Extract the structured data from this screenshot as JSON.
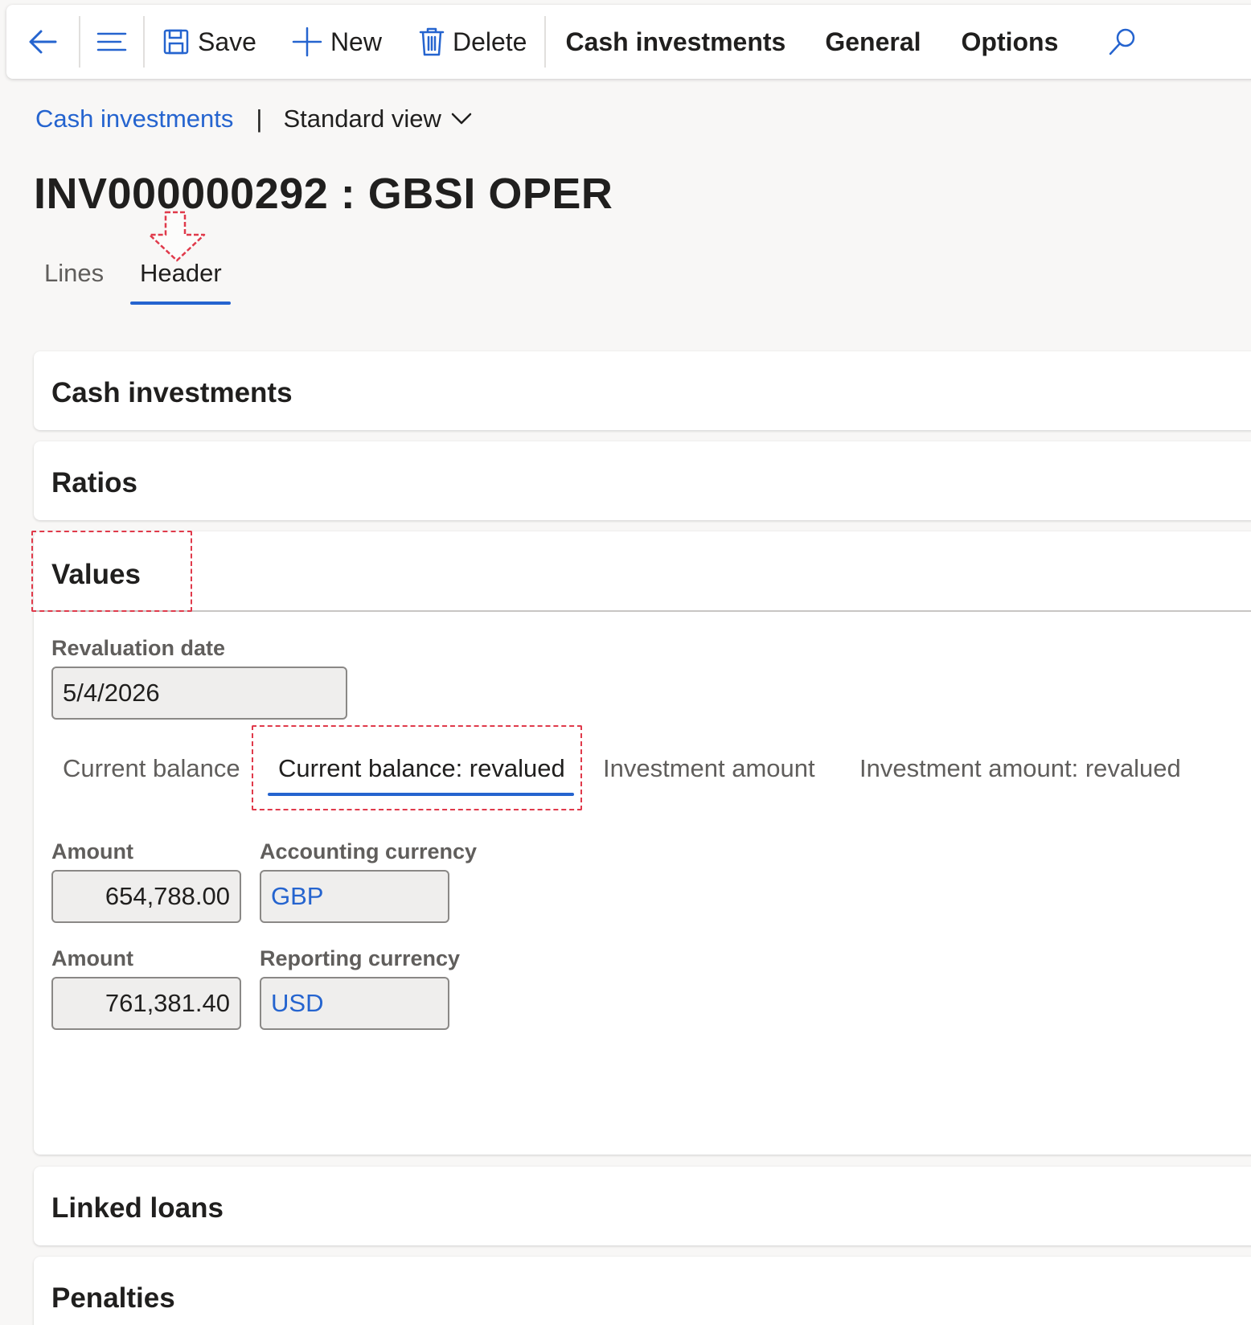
{
  "toolbar": {
    "back_icon": "back-arrow-icon",
    "menu_icon": "hamburger-icon",
    "save_label": "Save",
    "new_label": "New",
    "delete_label": "Delete",
    "tabs": [
      "Cash investments",
      "General",
      "Options"
    ],
    "search_icon": "search-icon"
  },
  "breadcrumb": {
    "link": "Cash investments",
    "separator": "|",
    "view": "Standard view"
  },
  "page_title": "INV000000292 : GBSI OPER",
  "record_tabs": [
    {
      "label": "Lines",
      "active": false
    },
    {
      "label": "Header",
      "active": true
    }
  ],
  "sections": {
    "cash_investments": "Cash investments",
    "ratios": "Ratios",
    "values": "Values",
    "linked_loans": "Linked loans",
    "penalties": "Penalties"
  },
  "values": {
    "revaluation_date_label": "Revaluation date",
    "revaluation_date": "5/4/2026",
    "subtabs": [
      {
        "label": "Current balance",
        "active": false
      },
      {
        "label": "Current balance: revalued",
        "active": true
      },
      {
        "label": "Investment amount",
        "active": false
      },
      {
        "label": "Investment amount: revalued",
        "active": false
      }
    ],
    "row1": {
      "amount_label": "Amount",
      "amount": "654,788.00",
      "currency_label": "Accounting currency",
      "currency": "GBP"
    },
    "row2": {
      "amount_label": "Amount",
      "amount": "761,381.40",
      "currency_label": "Reporting currency",
      "currency": "USD"
    }
  },
  "colors": {
    "accent": "#2564cf",
    "annotation_red": "#e03a4b"
  }
}
